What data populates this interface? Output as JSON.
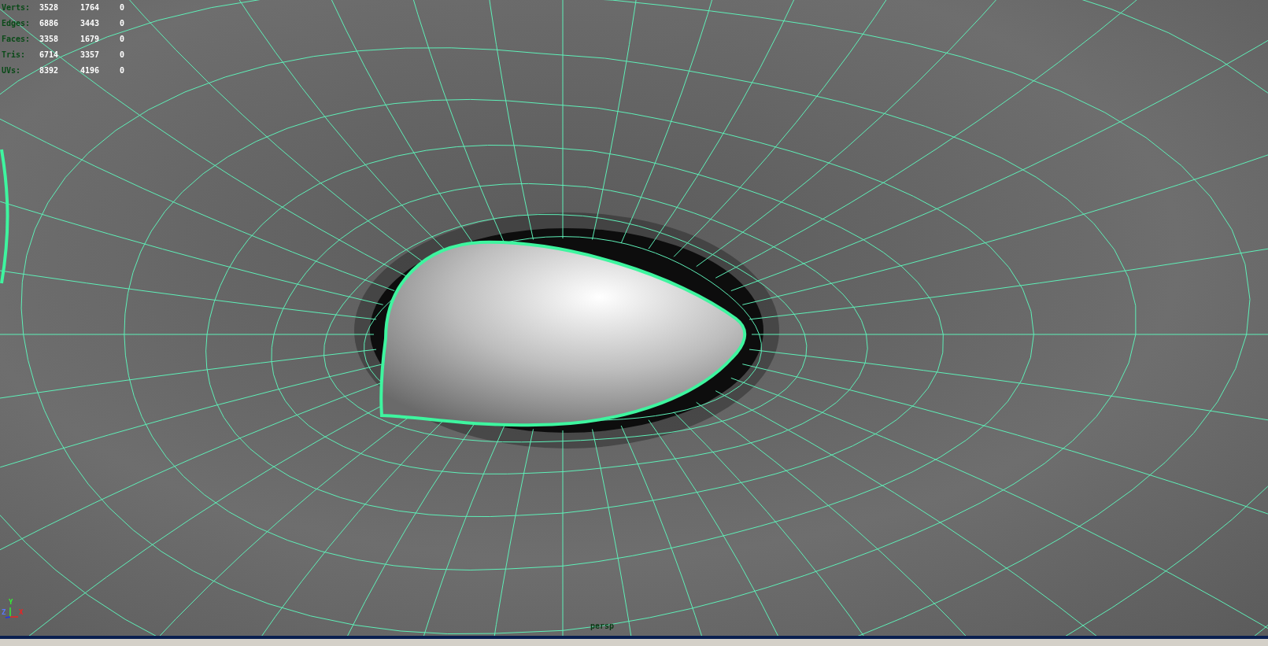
{
  "hud": {
    "stats": [
      {
        "label": "Verts:",
        "values": [
          "3528",
          "1764",
          "0"
        ]
      },
      {
        "label": "Edges:",
        "values": [
          "6886",
          "3443",
          "0"
        ]
      },
      {
        "label": "Faces:",
        "values": [
          "3358",
          "1679",
          "0"
        ]
      },
      {
        "label": "Tris:",
        "values": [
          "6714",
          "3357",
          "0"
        ]
      },
      {
        "label": "UVs:",
        "values": [
          "8392",
          "4196",
          "0"
        ]
      }
    ]
  },
  "axis": {
    "x": "X",
    "y": "Y",
    "z": "Z"
  },
  "camera_label": "persp"
}
